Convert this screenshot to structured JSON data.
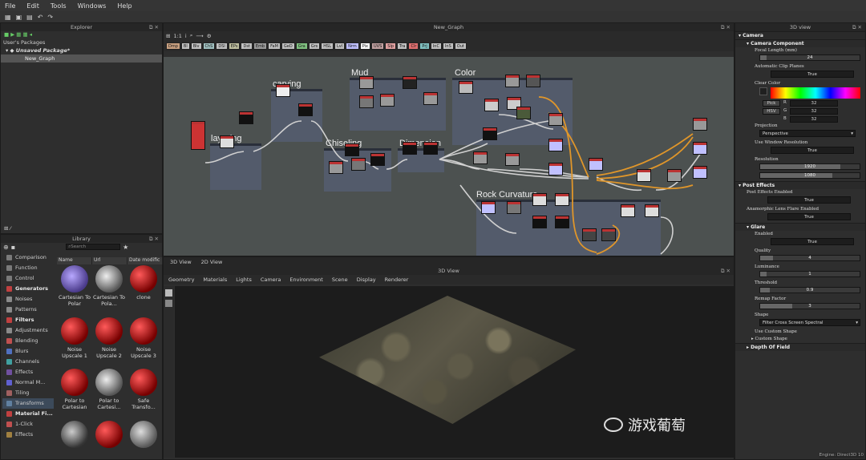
{
  "menu": [
    "File",
    "Edit",
    "Tools",
    "Windows",
    "Help"
  ],
  "explorer": {
    "title": "Explorer",
    "users_packages": "User's Packages",
    "package": "Unsaved Package*",
    "graph": "New_Graph"
  },
  "library": {
    "title": "Library",
    "search_placeholder": "Search",
    "columns": [
      "Name",
      "Url",
      "Date modific"
    ],
    "categories": [
      {
        "label": "Comparison",
        "type": "item",
        "color": "#7a7a7a"
      },
      {
        "label": "Function",
        "type": "item",
        "color": "#7a7a7a"
      },
      {
        "label": "Control",
        "type": "item",
        "color": "#7a7a7a"
      },
      {
        "label": "Generators",
        "type": "header",
        "color": "#c04040"
      },
      {
        "label": "Noises",
        "type": "item",
        "color": "#8a8a8a"
      },
      {
        "label": "Patterns",
        "type": "item",
        "color": "#8a8a8a"
      },
      {
        "label": "Filters",
        "type": "header",
        "color": "#c04040"
      },
      {
        "label": "Adjustments",
        "type": "item",
        "color": "#8a8a8a"
      },
      {
        "label": "Blending",
        "type": "item",
        "color": "#c05050"
      },
      {
        "label": "Blurs",
        "type": "item",
        "color": "#5070c0"
      },
      {
        "label": "Channels",
        "type": "item",
        "color": "#40a0a0"
      },
      {
        "label": "Effects",
        "type": "item",
        "color": "#7050a0"
      },
      {
        "label": "Normal M...",
        "type": "item",
        "color": "#6060d0"
      },
      {
        "label": "Tiling",
        "type": "item",
        "color": "#a06060"
      },
      {
        "label": "Transforms",
        "type": "item",
        "color": "#6080a0",
        "selected": true
      },
      {
        "label": "Material Fi...",
        "type": "header",
        "color": "#c04040"
      },
      {
        "label": "1-Click",
        "type": "item",
        "color": "#c05050"
      },
      {
        "label": "Effects",
        "type": "item",
        "color": "#a08040"
      }
    ],
    "thumbs": [
      {
        "label": "Cartesian To Polar",
        "style": "radial-gradient(circle at 40% 40%,#b8a8ff,#4a3a8a 70%)"
      },
      {
        "label": "Cartesian To Pola...",
        "style": "radial-gradient(circle at 40% 40%,#eee,#555 70%)"
      },
      {
        "label": "clone",
        "style": "radial-gradient(circle at 35% 35%,#ff5a5a,#700 70%)"
      },
      {
        "label": "Noise Upscale 1",
        "style": "radial-gradient(circle at 35% 35%,#ff5a5a,#700 70%)"
      },
      {
        "label": "Noise Upscale 2",
        "style": "radial-gradient(circle at 35% 35%,#ff5a5a,#700 70%)"
      },
      {
        "label": "Noise Upscale 3",
        "style": "radial-gradient(circle at 35% 35%,#ff5a5a,#700 70%)"
      },
      {
        "label": "Polar to Cartesian",
        "style": "radial-gradient(circle at 35% 35%,#ff5a5a,#700 70%)"
      },
      {
        "label": "Polar to Cartesi...",
        "style": "radial-gradient(circle at 40% 40%,#eee,#555 70%)"
      },
      {
        "label": "Safe Transfo...",
        "style": "radial-gradient(circle at 35% 35%,#ff5a5a,#700 70%)"
      },
      {
        "label": "",
        "style": "radial-gradient(circle at 40% 40%,#ccc,#333 70%)"
      },
      {
        "label": "",
        "style": "radial-gradient(circle at 35% 35%,#ff5a5a,#700 70%)"
      },
      {
        "label": "",
        "style": "radial-gradient(circle at 40% 40%,#ddd,#555 70%)"
      }
    ]
  },
  "graph": {
    "title": "New_Graph",
    "zoom": "1:1",
    "chips": [
      "Dmp",
      "Bl",
      "Blv",
      "ChS",
      "DSl",
      "EPs",
      "Dst",
      "Emb",
      "FaM",
      "GeD",
      "Gra",
      "Grs",
      "HSL",
      "Lvl",
      "Nrm",
      "Pix",
      "UVS",
      "Slp",
      "Tra",
      "Clr",
      "Prj",
      "InC",
      "InS",
      "Out"
    ],
    "frames": [
      "carving",
      "Mud",
      "Color",
      "layering",
      "Chiseling",
      "Dimension",
      "Rock Curvature"
    ]
  },
  "view3d": {
    "tabs": [
      "3D View",
      "2D View"
    ],
    "title": "3D View",
    "menu": [
      "Geometry",
      "Materials",
      "Lights",
      "Camera",
      "Environment",
      "Scene",
      "Display",
      "Renderer"
    ]
  },
  "props": {
    "title": "3D view",
    "camera": "Camera",
    "camera_component": "Camera Component",
    "focal_label": "Focal Length (mm)",
    "focal_value": "24",
    "auto_clip_label": "Automatic Clip Planes",
    "auto_clip_value": "True",
    "clear_color_label": "Clear Color",
    "pick": "Pick",
    "hsv": "HSV",
    "rgb": [
      {
        "k": "R",
        "v": "32"
      },
      {
        "k": "G",
        "v": "32"
      },
      {
        "k": "B",
        "v": "32"
      }
    ],
    "projection_label": "Projection",
    "projection_value": "Perspective",
    "use_window_label": "Use Window Resolution",
    "use_window_value": "True",
    "resolution_label": "Resolution",
    "res_w": "1920",
    "res_h": "1080",
    "post_effects": "Post Effects",
    "post_enabled_label": "Post Effects Enabled",
    "post_enabled_value": "True",
    "anamorphic_label": "Anamorphic Lens Flare Enabled",
    "anamorphic_value": "True",
    "glare": "Glare",
    "enabled_label": "Enabled",
    "enabled_value": "True",
    "quality_label": "Quality",
    "quality_value": "4",
    "luminance_label": "Luminance",
    "luminance_value": "1",
    "threshold_label": "Threshold",
    "threshold_value": "0.9",
    "remap_label": "Remap Factor",
    "remap_value": "3",
    "shape_label": "Shape",
    "shape_value": "Filter Cross Screen Spectral",
    "custom_shape_label": "Use Custom Shape",
    "custom_shape_sub": "Custom Shape",
    "dof": "Depth Of Field"
  },
  "status": "Engine: Direct3D 10",
  "watermark": "游戏葡萄"
}
